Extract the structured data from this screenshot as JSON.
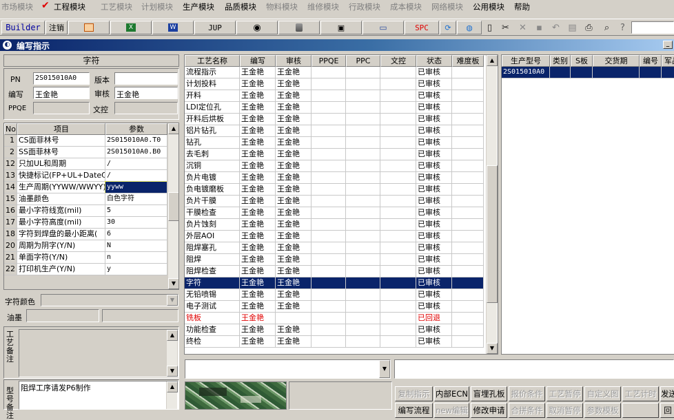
{
  "menu": [
    "市场模块",
    "工程模块",
    "工艺模块",
    "计划模块",
    "生产模块",
    "品质模块",
    "物料模块",
    "维修模块",
    "行政模块",
    "成本模块",
    "网络模块",
    "公用模块",
    "帮助"
  ],
  "toolbar": {
    "builder": "Builder",
    "logout": "注销",
    "jup": "JUP",
    "spc": "SPC"
  },
  "window": {
    "title": "编写指示"
  },
  "left": {
    "heading": "字符",
    "pn_label": "PN",
    "pn_value": "2S015010A0",
    "version_label": "版本",
    "version_value": "",
    "author_label": "编写",
    "author_value": "王金艳",
    "reviewer_label": "审核",
    "reviewer_value": "王金艳",
    "ppqe_label": "PPQE",
    "ppqe_value": "",
    "doc_control_label": "文控",
    "doc_control_value": ""
  },
  "params": {
    "headers": [
      "No",
      "项目",
      "参数"
    ],
    "rows": [
      [
        "1",
        "CS面菲林号",
        "2S015010A0.T0"
      ],
      [
        "2",
        "SS面菲林号",
        "2S015010A0.B0"
      ],
      [
        "12",
        "只加UL和周期",
        "/"
      ],
      [
        "13",
        "快捷标记(FP+UL+DateCo",
        "/"
      ],
      [
        "14",
        "生产周期(YYWW/WWYY)",
        "yyww"
      ],
      [
        "15",
        "油墨颜色",
        "白色字符"
      ],
      [
        "16",
        "最小字符线宽(mil)",
        "5"
      ],
      [
        "17",
        "最小字符高度(mil)",
        "30"
      ],
      [
        "18",
        "字符到焊盘的最小距离(",
        "6"
      ],
      [
        "20",
        "周期为阴字(Y/N)",
        "N"
      ],
      [
        "21",
        "单面字符(Y/N)",
        "n"
      ],
      [
        "22",
        "打印机生产(Y/N)",
        "y"
      ]
    ]
  },
  "char_color_label": "字符颜色",
  "ink_label": "油墨",
  "process_note_label": "工艺备注",
  "model_note_label": "型号备注",
  "model_note_text": "阻焊工序请发P6制作",
  "process": {
    "headers": [
      "工艺名称",
      "编写",
      "审核",
      "PPQE",
      "PPC",
      "文控",
      "状态",
      "难度板"
    ],
    "rows": [
      [
        "流程指示",
        "王金艳",
        "王金艳",
        "",
        "",
        "",
        "已审核",
        ""
      ],
      [
        "计划投料",
        "王金艳",
        "王金艳",
        "",
        "",
        "",
        "已审核",
        ""
      ],
      [
        "开料",
        "王金艳",
        "王金艳",
        "",
        "",
        "",
        "已审核",
        ""
      ],
      [
        "LDI定位孔",
        "王金艳",
        "王金艳",
        "",
        "",
        "",
        "已审核",
        ""
      ],
      [
        "开料后烘板",
        "王金艳",
        "王金艳",
        "",
        "",
        "",
        "已审核",
        ""
      ],
      [
        "铝片钻孔",
        "王金艳",
        "王金艳",
        "",
        "",
        "",
        "已审核",
        ""
      ],
      [
        "钻孔",
        "王金艳",
        "王金艳",
        "",
        "",
        "",
        "已审核",
        ""
      ],
      [
        "去毛刺",
        "王金艳",
        "王金艳",
        "",
        "",
        "",
        "已审核",
        ""
      ],
      [
        "沉铜",
        "王金艳",
        "王金艳",
        "",
        "",
        "",
        "已审核",
        ""
      ],
      [
        "负片电镀",
        "王金艳",
        "王金艳",
        "",
        "",
        "",
        "已审核",
        ""
      ],
      [
        "负电镀磨板",
        "王金艳",
        "王金艳",
        "",
        "",
        "",
        "已审核",
        ""
      ],
      [
        "负片干膜",
        "王金艳",
        "王金艳",
        "",
        "",
        "",
        "已审核",
        ""
      ],
      [
        "干膜检查",
        "王金艳",
        "王金艳",
        "",
        "",
        "",
        "已审核",
        ""
      ],
      [
        "负片蚀刻",
        "王金艳",
        "王金艳",
        "",
        "",
        "",
        "已审核",
        ""
      ],
      [
        "外层AOI",
        "王金艳",
        "王金艳",
        "",
        "",
        "",
        "已审核",
        ""
      ],
      [
        "阻焊塞孔",
        "王金艳",
        "王金艳",
        "",
        "",
        "",
        "已审核",
        ""
      ],
      [
        "阻焊",
        "王金艳",
        "王金艳",
        "",
        "",
        "",
        "已审核",
        ""
      ],
      [
        "阻焊检查",
        "王金艳",
        "王金艳",
        "",
        "",
        "",
        "已审核",
        ""
      ],
      [
        "字符",
        "王金艳",
        "王金艳",
        "",
        "",
        "",
        "已审核",
        ""
      ],
      [
        "无铅喷锡",
        "王金艳",
        "王金艳",
        "",
        "",
        "",
        "已审核",
        ""
      ],
      [
        "电子测试",
        "王金艳",
        "王金艳",
        "",
        "",
        "",
        "已审核",
        ""
      ],
      [
        "铣板",
        "王金艳",
        "",
        "",
        "",
        "",
        "已回退",
        ""
      ],
      [
        "功能检查",
        "王金艳",
        "王金艳",
        "",
        "",
        "",
        "已审核",
        ""
      ],
      [
        "终检",
        "王金艳",
        "王金艳",
        "",
        "",
        "",
        "已审核",
        ""
      ]
    ]
  },
  "orders": {
    "headers": [
      "生产型号",
      "类别",
      "S板",
      "交货期",
      "编号",
      "军品"
    ],
    "rows": [
      [
        "2S015010A0",
        "",
        "",
        "",
        "",
        ""
      ]
    ]
  },
  "buttons_row1": [
    {
      "label": "复制指示",
      "enabled": false
    },
    {
      "label": "内部ECN",
      "enabled": true
    },
    {
      "label": "盲埋孔板",
      "enabled": true
    },
    {
      "label": "报价条件",
      "enabled": false
    },
    {
      "label": "工艺暂停",
      "enabled": false
    },
    {
      "label": "自定义图",
      "enabled": false
    },
    {
      "label": "工艺计时",
      "enabled": false
    },
    {
      "label": "发送",
      "enabled": true
    }
  ],
  "buttons_row2": [
    {
      "label": "编写流程",
      "enabled": true
    },
    {
      "label": "new编辑",
      "enabled": false
    },
    {
      "label": "修改申请",
      "enabled": true
    },
    {
      "label": "合拼条件",
      "enabled": false
    },
    {
      "label": "取消暂停",
      "enabled": false
    },
    {
      "label": "参数模板",
      "enabled": false
    },
    {
      "label": "",
      "enabled": false
    },
    {
      "label": "回",
      "enabled": true
    }
  ],
  "colors": {
    "selection": "#0a246a",
    "reverted": "#e00000",
    "accent_check": "#e00000"
  }
}
